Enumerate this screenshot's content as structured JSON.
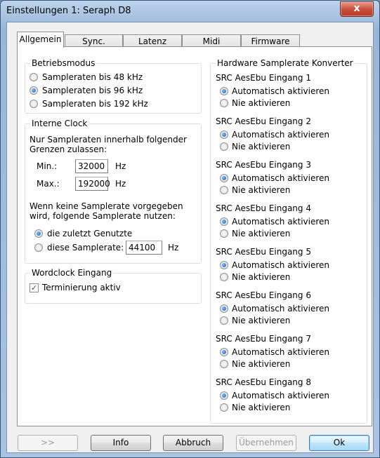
{
  "window": {
    "title": "Einstellungen 1: Seraph D8",
    "close_glyph": "x"
  },
  "tabs": [
    {
      "label": "Allgemein",
      "active": true
    },
    {
      "label": "Sync.",
      "active": false
    },
    {
      "label": "Latenz",
      "active": false
    },
    {
      "label": "Midi",
      "active": false
    },
    {
      "label": "Firmware",
      "active": false
    }
  ],
  "betriebsmodus": {
    "title": "Betriebsmodus",
    "options": [
      {
        "label": "Sampleraten bis 48 kHz",
        "checked": false
      },
      {
        "label": "Sampleraten bis 96 kHz",
        "checked": true
      },
      {
        "label": "Sampleraten bis 192 kHz",
        "checked": false
      }
    ]
  },
  "interne_clock": {
    "title": "Interne Clock",
    "desc_line1": "Nur Sampleraten innerhalb folgender",
    "desc_line2": "Grenzen zulassen:",
    "min_label": "Min.:",
    "min_value": "32000",
    "min_unit": "Hz",
    "max_label": "Max.:",
    "max_value": "192000",
    "max_unit": "Hz",
    "fallback_line1": "Wenn keine Samplerate vorgegeben",
    "fallback_line2": "wird, folgende Samplerate nutzen:",
    "opt_last_used": "die zuletzt Genutzte",
    "opt_this_rate": "diese Samplerate:",
    "rate_value": "44100",
    "rate_unit": "Hz"
  },
  "wordclock": {
    "title": "Wordclock Eingang",
    "termination_label": "Terminierung aktiv",
    "termination_checked": true
  },
  "src": {
    "title": "Hardware Samplerate Konverter",
    "auto_label": "Automatisch aktivieren",
    "never_label": "Nie aktivieren",
    "inputs": [
      "SRC AesEbu Eingang 1",
      "SRC AesEbu Eingang 2",
      "SRC AesEbu Eingang 3",
      "SRC AesEbu Eingang 4",
      "SRC AesEbu Eingang 5",
      "SRC AesEbu Eingang 6",
      "SRC AesEbu Eingang 7",
      "SRC AesEbu Eingang 8"
    ]
  },
  "buttons": {
    "more": ">>",
    "info": "Info",
    "cancel": "Abbruch",
    "apply": "Übernehmen",
    "ok": "Ok"
  }
}
